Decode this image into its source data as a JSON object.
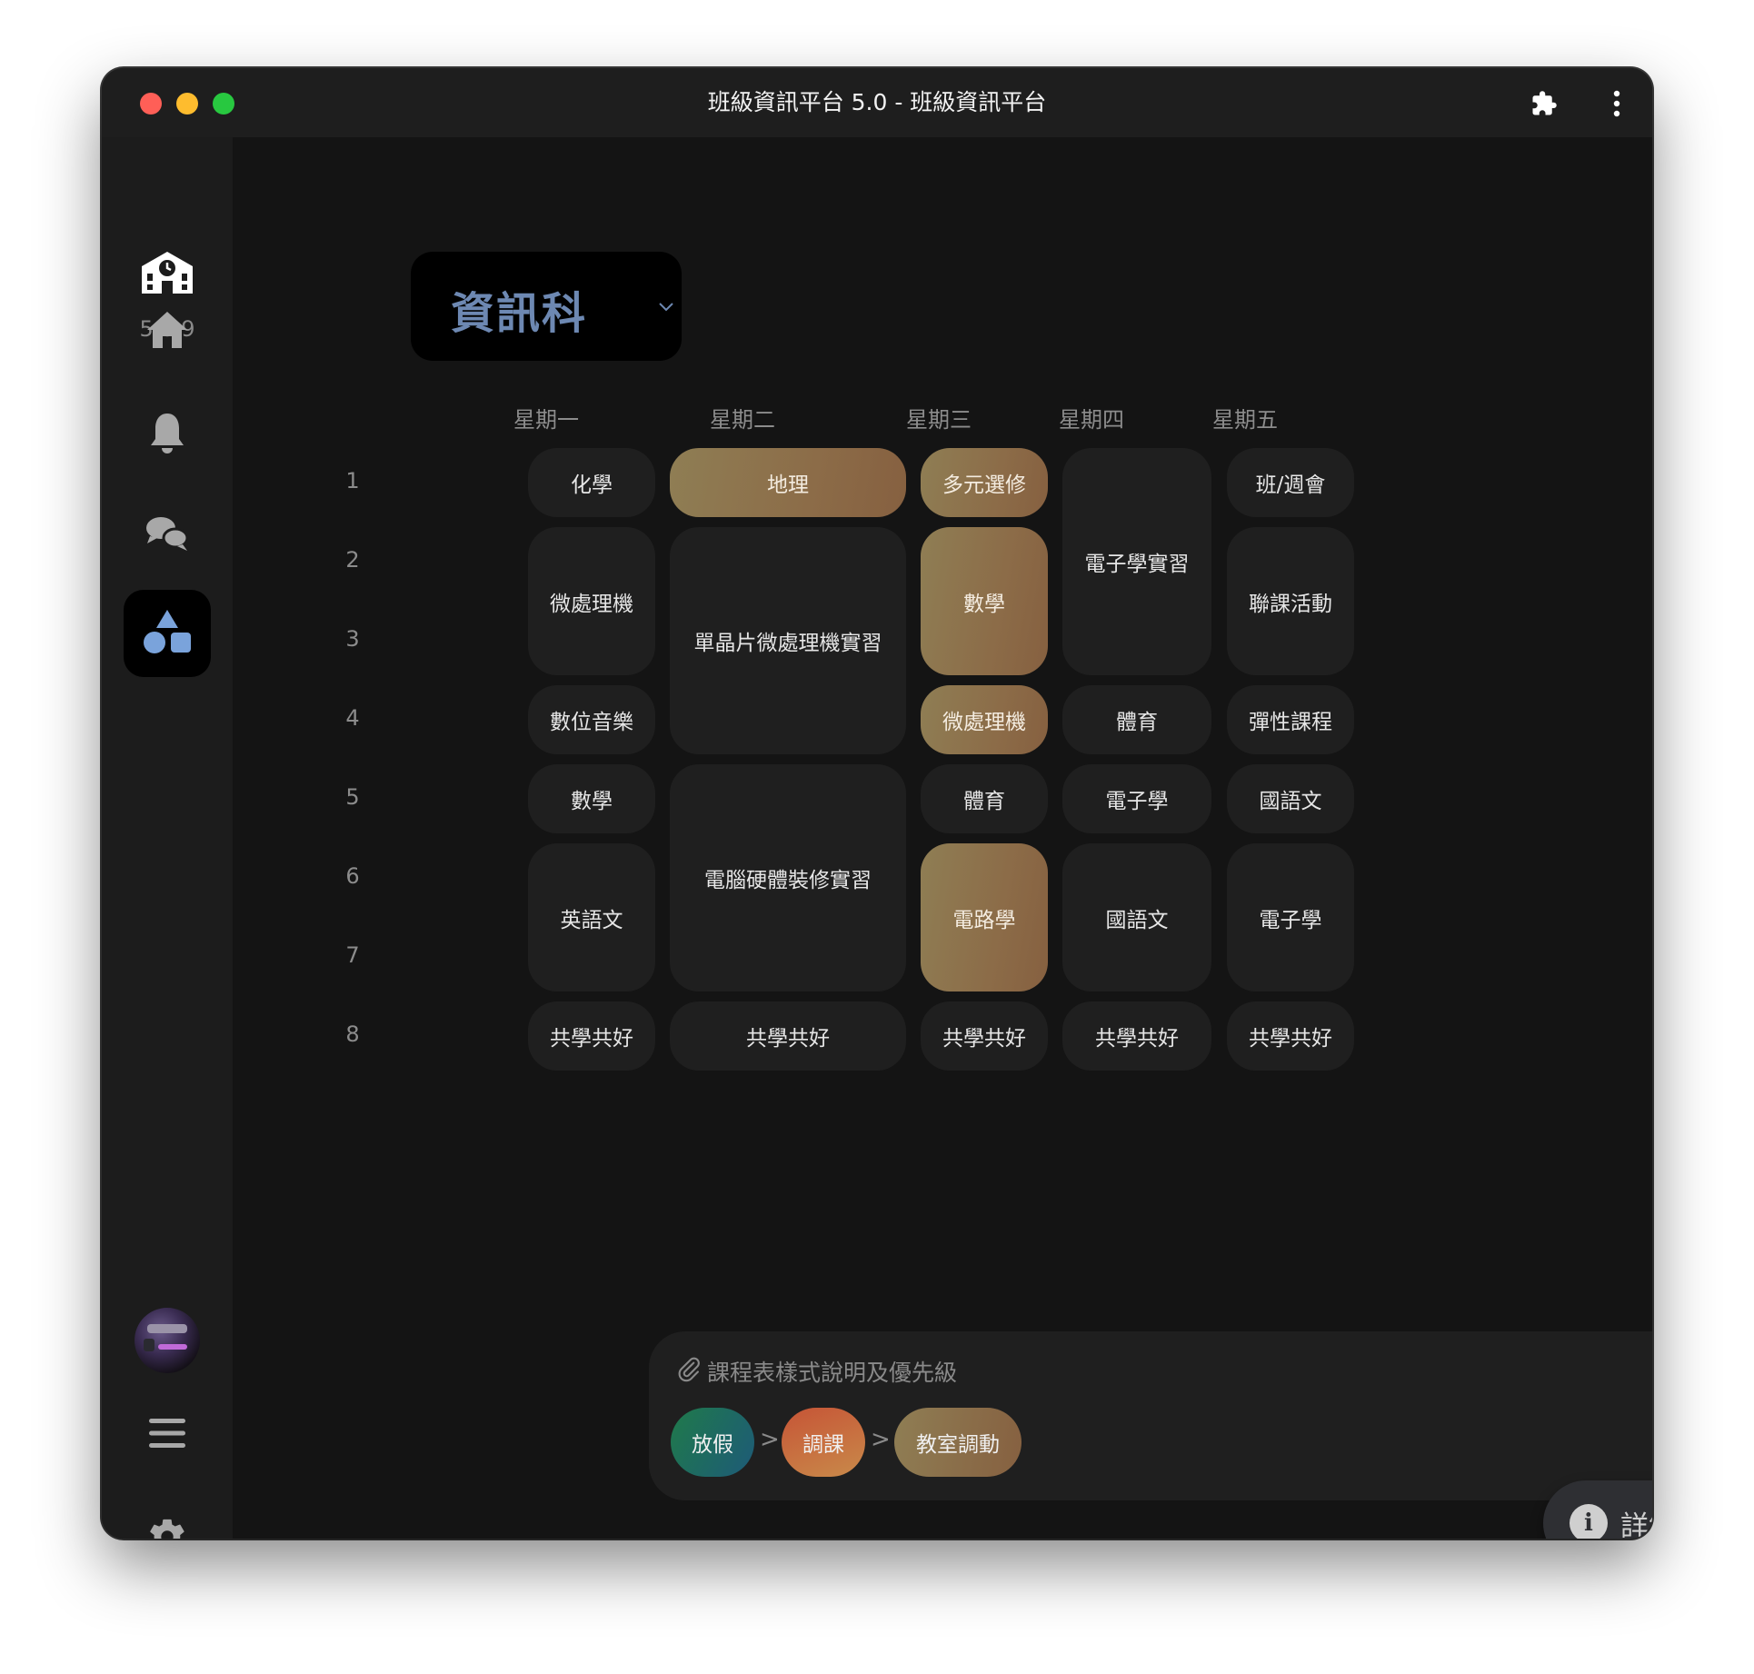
{
  "window": {
    "title": "班級資訊平台 5.0 - 班級資訊平台"
  },
  "sidebar": {
    "version": "5.8.9",
    "items": [
      {
        "icon": "home-icon",
        "label": "home"
      },
      {
        "icon": "bell-icon",
        "label": "notifications"
      },
      {
        "icon": "shapes-icon",
        "label": "timetable",
        "active": true
      },
      {
        "icon": "chat-icon",
        "label": "chat"
      }
    ],
    "bottom": [
      {
        "icon": "avatar"
      },
      {
        "icon": "menu-icon"
      },
      {
        "icon": "gear-icon"
      }
    ]
  },
  "department": {
    "selected": "資訊科"
  },
  "timetable": {
    "days": [
      "星期一",
      "星期二",
      "星期三",
      "星期四",
      "星期五"
    ],
    "periods": [
      "1",
      "2",
      "3",
      "4",
      "5",
      "6",
      "7",
      "8"
    ],
    "cells": [
      {
        "day": "星期一",
        "periods": [
          1
        ],
        "label": "化學"
      },
      {
        "day": "星期一",
        "periods": [
          2,
          3
        ],
        "label": "微處理機"
      },
      {
        "day": "星期一",
        "periods": [
          4
        ],
        "label": "數位音樂"
      },
      {
        "day": "星期一",
        "periods": [
          5
        ],
        "label": "數學"
      },
      {
        "day": "星期一",
        "periods": [
          6,
          7
        ],
        "label": "英語文"
      },
      {
        "day": "星期一",
        "periods": [
          8
        ],
        "label": "共學共好"
      },
      {
        "day": "星期二",
        "periods": [
          1
        ],
        "label": "地理",
        "highlight": "教室調動"
      },
      {
        "day": "星期二",
        "periods": [
          2,
          3,
          4
        ],
        "label": "單晶片微處理機實習"
      },
      {
        "day": "星期二",
        "periods": [
          5,
          6,
          7
        ],
        "label": "電腦硬體裝修實習"
      },
      {
        "day": "星期二",
        "periods": [
          8
        ],
        "label": "共學共好"
      },
      {
        "day": "星期三",
        "periods": [
          1
        ],
        "label": "多元選修",
        "highlight": "教室調動"
      },
      {
        "day": "星期三",
        "periods": [
          2,
          3
        ],
        "label": "數學",
        "highlight": "教室調動"
      },
      {
        "day": "星期三",
        "periods": [
          4
        ],
        "label": "微處理機",
        "highlight": "教室調動"
      },
      {
        "day": "星期三",
        "periods": [
          5
        ],
        "label": "體育"
      },
      {
        "day": "星期三",
        "periods": [
          6,
          7
        ],
        "label": "電路學",
        "highlight": "教室調動"
      },
      {
        "day": "星期三",
        "periods": [
          8
        ],
        "label": "共學共好"
      },
      {
        "day": "星期四",
        "periods": [
          1,
          2,
          3
        ],
        "label": "電子學實習"
      },
      {
        "day": "星期四",
        "periods": [
          4
        ],
        "label": "體育"
      },
      {
        "day": "星期四",
        "periods": [
          5
        ],
        "label": "電子學"
      },
      {
        "day": "星期四",
        "periods": [
          6,
          7
        ],
        "label": "國語文"
      },
      {
        "day": "星期四",
        "periods": [
          8
        ],
        "label": "共學共好"
      },
      {
        "day": "星期五",
        "periods": [
          1
        ],
        "label": "班/週會"
      },
      {
        "day": "星期五",
        "periods": [
          2,
          3
        ],
        "label": "聯課活動"
      },
      {
        "day": "星期五",
        "periods": [
          4
        ],
        "label": "彈性課程"
      },
      {
        "day": "星期五",
        "periods": [
          5
        ],
        "label": "國語文"
      },
      {
        "day": "星期五",
        "periods": [
          6,
          7
        ],
        "label": "電子學"
      },
      {
        "day": "星期五",
        "periods": [
          8
        ],
        "label": "共學共好"
      }
    ]
  },
  "legend": {
    "title": "課程表樣式說明及優先級",
    "holiday": "放假",
    "swap": "調課",
    "room_change": "教室調動",
    "separator": ">"
  },
  "detail_button": {
    "label": "詳細資訊"
  },
  "colors": {
    "room_change": "#8c6c48",
    "holiday": "#1f7a4a",
    "swap": "#c65436",
    "department_text": "#6d88b2"
  }
}
